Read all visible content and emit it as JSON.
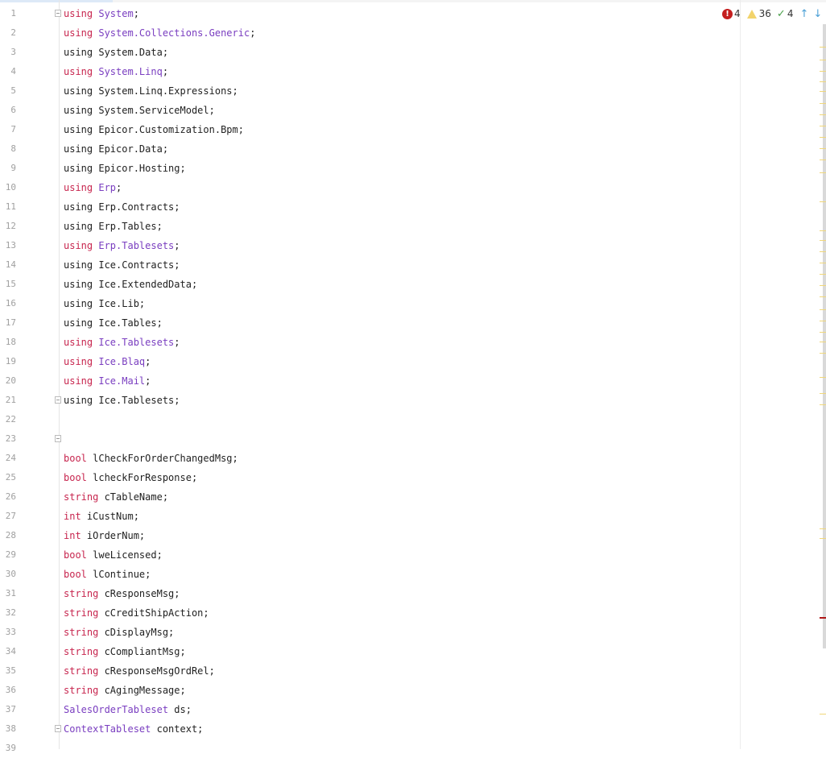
{
  "editor": {
    "lines": [
      {
        "n": "1",
        "fold": true,
        "tokens": [
          {
            "t": "using",
            "c": "kw"
          },
          {
            "t": " "
          },
          {
            "t": "System",
            "c": "ty"
          },
          {
            "t": ";"
          }
        ]
      },
      {
        "n": "2",
        "tokens": [
          {
            "t": "using",
            "c": "kw"
          },
          {
            "t": " "
          },
          {
            "t": "System.Collections.Generic",
            "c": "ty"
          },
          {
            "t": ";"
          }
        ]
      },
      {
        "n": "3",
        "tokens": [
          {
            "t": "using System.Data;"
          }
        ]
      },
      {
        "n": "4",
        "tokens": [
          {
            "t": "using",
            "c": "kw"
          },
          {
            "t": " "
          },
          {
            "t": "System.Linq",
            "c": "ty"
          },
          {
            "t": ";"
          }
        ]
      },
      {
        "n": "5",
        "tokens": [
          {
            "t": "using System.Linq.Expressions;"
          }
        ]
      },
      {
        "n": "6",
        "tokens": [
          {
            "t": "using System.ServiceModel;"
          }
        ]
      },
      {
        "n": "7",
        "tokens": [
          {
            "t": "using Epicor.Customization.Bpm;"
          }
        ]
      },
      {
        "n": "8",
        "tokens": [
          {
            "t": "using Epicor.Data;"
          }
        ]
      },
      {
        "n": "9",
        "tokens": [
          {
            "t": "using Epicor.Hosting;"
          }
        ]
      },
      {
        "n": "10",
        "tokens": [
          {
            "t": "using",
            "c": "kw"
          },
          {
            "t": " "
          },
          {
            "t": "Erp",
            "c": "ty"
          },
          {
            "t": ";"
          }
        ]
      },
      {
        "n": "11",
        "tokens": [
          {
            "t": "using Erp.Contracts;"
          }
        ]
      },
      {
        "n": "12",
        "tokens": [
          {
            "t": "using Erp.Tables;"
          }
        ]
      },
      {
        "n": "13",
        "tokens": [
          {
            "t": "using",
            "c": "kw"
          },
          {
            "t": " "
          },
          {
            "t": "Erp.Tablesets",
            "c": "ty"
          },
          {
            "t": ";"
          }
        ]
      },
      {
        "n": "14",
        "tokens": [
          {
            "t": "using Ice.Contracts;"
          }
        ]
      },
      {
        "n": "15",
        "tokens": [
          {
            "t": "using Ice.ExtendedData;"
          }
        ]
      },
      {
        "n": "16",
        "tokens": [
          {
            "t": "using Ice.Lib;"
          }
        ]
      },
      {
        "n": "17",
        "tokens": [
          {
            "t": "using Ice.Tables;"
          }
        ]
      },
      {
        "n": "18",
        "tokens": [
          {
            "t": "using",
            "c": "kw"
          },
          {
            "t": " "
          },
          {
            "t": "Ice.Tablesets",
            "c": "ty"
          },
          {
            "t": ";"
          }
        ]
      },
      {
        "n": "19",
        "tokens": [
          {
            "t": "using",
            "c": "kw"
          },
          {
            "t": " "
          },
          {
            "t": "Ice.Blaq",
            "c": "ty"
          },
          {
            "t": ";"
          }
        ]
      },
      {
        "n": "20",
        "tokens": [
          {
            "t": "using",
            "c": "kw"
          },
          {
            "t": " "
          },
          {
            "t": "Ice.Mail",
            "c": "ty"
          },
          {
            "t": ";"
          }
        ]
      },
      {
        "n": "21",
        "fold": true,
        "tokens": [
          {
            "t": "using Ice.Tablesets;"
          }
        ]
      },
      {
        "n": "22",
        "tokens": []
      },
      {
        "n": "23",
        "fold": true,
        "tokens": []
      },
      {
        "n": "24",
        "tokens": [
          {
            "t": "bool",
            "c": "kw"
          },
          {
            "t": " lCheckForOrderChangedMsg;"
          }
        ]
      },
      {
        "n": "25",
        "tokens": [
          {
            "t": "bool",
            "c": "kw"
          },
          {
            "t": " lcheckForResponse;"
          }
        ]
      },
      {
        "n": "26",
        "tokens": [
          {
            "t": "string",
            "c": "kw"
          },
          {
            "t": " cTableName;"
          }
        ]
      },
      {
        "n": "27",
        "tokens": [
          {
            "t": "int",
            "c": "kw"
          },
          {
            "t": " iCustNum;"
          }
        ]
      },
      {
        "n": "28",
        "tokens": [
          {
            "t": "int",
            "c": "kw"
          },
          {
            "t": " iOrderNum;"
          }
        ]
      },
      {
        "n": "29",
        "tokens": [
          {
            "t": "bool",
            "c": "kw"
          },
          {
            "t": " lweLicensed;"
          }
        ]
      },
      {
        "n": "30",
        "tokens": [
          {
            "t": "bool",
            "c": "kw"
          },
          {
            "t": " lContinue;"
          }
        ]
      },
      {
        "n": "31",
        "tokens": [
          {
            "t": "string",
            "c": "kw"
          },
          {
            "t": " cResponseMsg;"
          }
        ]
      },
      {
        "n": "32",
        "tokens": [
          {
            "t": "string",
            "c": "kw"
          },
          {
            "t": " cCreditShipAction;"
          }
        ]
      },
      {
        "n": "33",
        "tokens": [
          {
            "t": "string",
            "c": "kw"
          },
          {
            "t": " cDisplayMsg;"
          }
        ]
      },
      {
        "n": "34",
        "tokens": [
          {
            "t": "string",
            "c": "kw"
          },
          {
            "t": " cCompliantMsg;"
          }
        ]
      },
      {
        "n": "35",
        "tokens": [
          {
            "t": "string",
            "c": "kw"
          },
          {
            "t": " cResponseMsgOrdRel;"
          }
        ]
      },
      {
        "n": "36",
        "tokens": [
          {
            "t": "string",
            "c": "kw"
          },
          {
            "t": " cAgingMessage;"
          }
        ]
      },
      {
        "n": "37",
        "tokens": [
          {
            "t": "SalesOrderTableset",
            "c": "ty"
          },
          {
            "t": " ds;"
          }
        ]
      },
      {
        "n": "38",
        "fold": true,
        "tokens": [
          {
            "t": "ContextTableset",
            "c": "ty"
          },
          {
            "t": " context;"
          }
        ]
      },
      {
        "n": "39",
        "tokens": []
      }
    ]
  },
  "inspections": {
    "errors": "4",
    "warnings": "36",
    "ok": "4",
    "error_icon": "error-icon",
    "warning_icon": "warning-icon",
    "ok_icon": "check-icon",
    "colors": {
      "error": "#c41e1e",
      "warning": "#e8c84a",
      "ok": "#4aa04a",
      "nav": "#4a9fd6"
    }
  },
  "syntax_colors": {
    "keyword": "#c7254e",
    "type": "#7a3ec0",
    "plain": "#1f1f1f",
    "line_number": "#a0a0a0"
  }
}
